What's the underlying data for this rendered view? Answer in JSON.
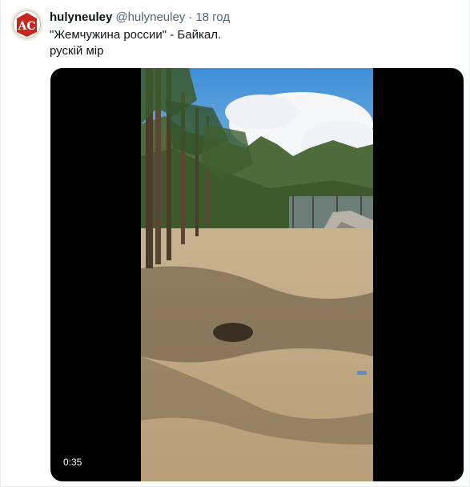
{
  "user": {
    "display_name": "hulyneuley",
    "handle": "@hulyneuley",
    "separator": "·",
    "time": "18 год",
    "avatar_text": "AC",
    "avatar_color": "#c8271e"
  },
  "tweet": {
    "text_line1": "\"Жемчужина россии\" - Байкал.",
    "text_line2": "рускій мір"
  },
  "media": {
    "type": "video",
    "duration": "0:35"
  },
  "colors": {
    "text_primary": "#0f1419",
    "text_secondary": "#536471",
    "media_background": "#000000"
  }
}
